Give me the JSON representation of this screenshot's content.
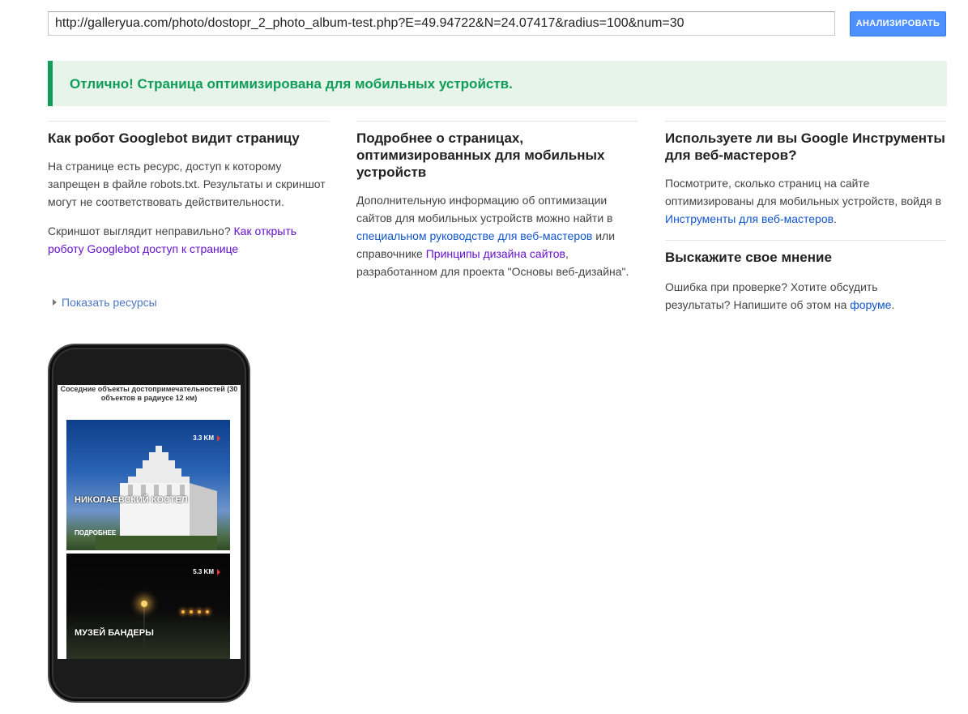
{
  "search": {
    "url_value": "http://galleryua.com/photo/dostopr_2_photo_album-test.php?E=49.94722&N=24.07417&radius=100&num=30",
    "button_label": "АНАЛИЗИРОВАТЬ"
  },
  "banner": {
    "text": "Отлично! Страница оптимизирована для мобильных устройств."
  },
  "col1": {
    "title": "Как робот Googlebot видит страницу",
    "paragraph1": "На странице есть ресурс, доступ к которому запрещен в файле robots.txt. Результаты и скриншот могут не соответствовать действительности.",
    "paragraph2_prefix": "Скриншот выглядит неправильно? ",
    "paragraph2_link": "Как открыть роботу Googlebot доступ к странице",
    "show_resources": "Показать ресурсы"
  },
  "col2": {
    "title": "Подробнее о страницах, оптимизированных для мобильных устройств",
    "text_1": "Дополнительную информацию об оптимизации сайтов для мобильных устройств можно найти в ",
    "link_1": "специальном руководстве для веб-мастеров",
    "text_2": " или справочнике ",
    "link_2": "Принципы дизайна сайтов",
    "text_3": ", разработанном для проекта \"Основы веб-дизайна\"."
  },
  "col3": {
    "title": "Используете ли вы Google Инструменты для веб-мастеров?",
    "text_1": "Посмотрите, сколько страниц на сайте оптимизированы для мобильных устройств, войдя в ",
    "link_1": "Инструменты для веб-мастеров",
    "text_2": ".",
    "feedback_title": "Выскажите свое мнение",
    "feedback_text_1": "Ошибка при проверке? Хотите обсудить результаты? Напишите об этом на ",
    "feedback_link": "форуме",
    "feedback_text_2": "."
  },
  "phone": {
    "screen_title": "Соседние объекты достопримечательностей (30 объектов в радиусе 12 км)",
    "cards": [
      {
        "distance": "3.3 KM",
        "name": "НИКОЛАЕВСКИЙ КОСТЕЛ",
        "more": "ПОДРОБНЕЕ"
      },
      {
        "distance": "5.3 KM",
        "name": "МУЗЕЙ БАНДЕРЫ"
      }
    ]
  },
  "colors": {
    "accent_blue": "#4d90fe",
    "success_green": "#0f9d58",
    "banner_bg": "#e6f4ea",
    "link": "#1155cc",
    "visited_link": "#6611cc"
  }
}
